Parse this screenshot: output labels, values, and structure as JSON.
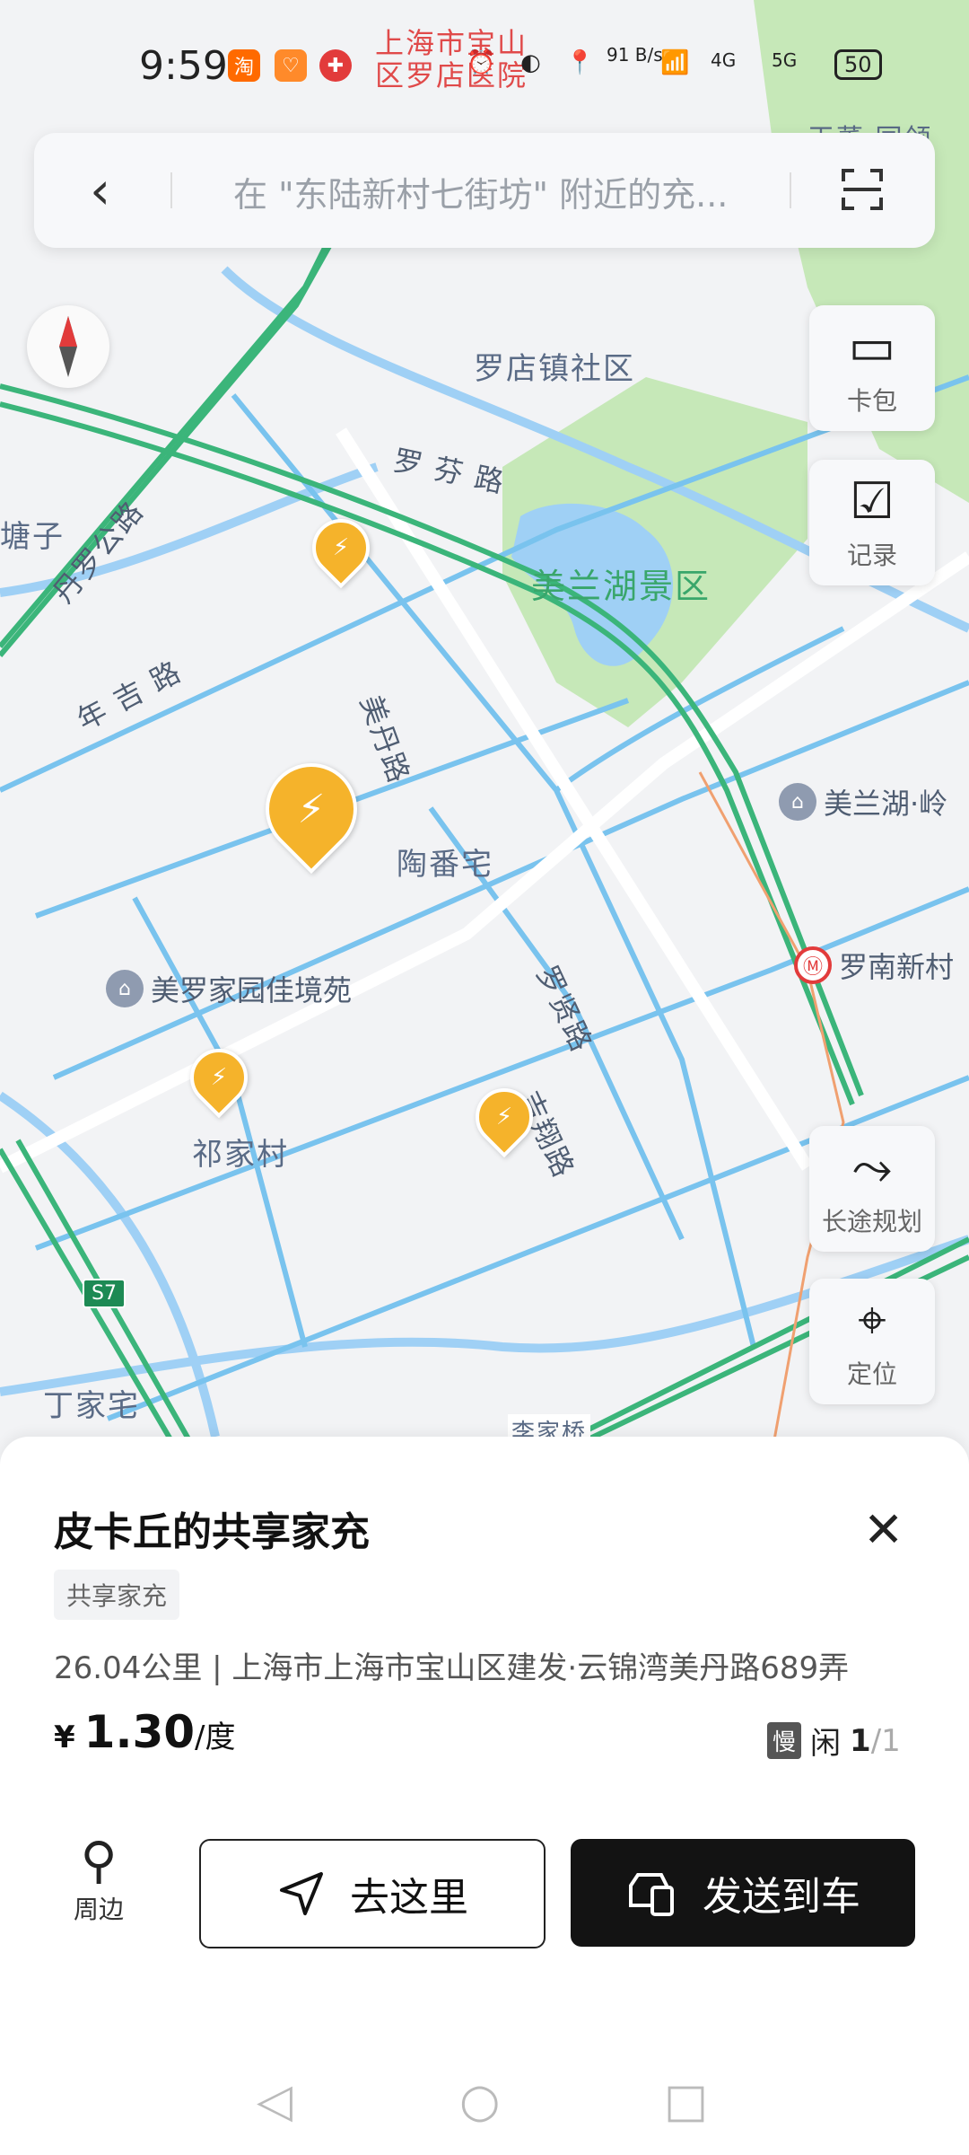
{
  "status_bar": {
    "time": "9:59",
    "app_icons": [
      "taobao-icon",
      "heart-app-icon",
      "medical-pin-icon"
    ],
    "network_speed": "91 B/s",
    "signal_1": "4G",
    "signal_2": "5G",
    "battery": "50"
  },
  "search": {
    "placeholder": "在 \"东陆新村七街坊\" 附近的充..."
  },
  "map": {
    "labels": [
      {
        "id": "luodian-community",
        "text": "罗店镇社区"
      },
      {
        "id": "luofen-road",
        "text": "罗 芬 路"
      },
      {
        "id": "danluo-road",
        "text": "丹罗公路"
      },
      {
        "id": "meilan-lake",
        "text": "美兰湖景区"
      },
      {
        "id": "nianji-road",
        "text": "年 吉 路"
      },
      {
        "id": "meidan-road",
        "text": "美丹路"
      },
      {
        "id": "taofanzhai",
        "text": "陶番宅"
      },
      {
        "id": "luoxian-road",
        "text": "罗贤路"
      },
      {
        "id": "jixiang-road",
        "text": "吉翔路"
      },
      {
        "id": "qijiacun",
        "text": "祁家村"
      },
      {
        "id": "dingjiazhai",
        "text": "丁家宅"
      },
      {
        "id": "lijiaqiao",
        "text": "李家桥"
      },
      {
        "id": "tangzi",
        "text": "塘子"
      },
      {
        "id": "hospital",
        "text": "上海市宝山区罗店医院"
      },
      {
        "id": "top-right-place",
        "text": "王董·园领"
      }
    ],
    "pois": [
      {
        "id": "meiluo-garden",
        "text": "美罗家园佳境苑"
      },
      {
        "id": "meilanhu-ling",
        "text": "美兰湖·岭"
      },
      {
        "id": "luonan-metro",
        "text": "罗南新村"
      }
    ],
    "highway_badge": "S7",
    "highlight_color": "#f5b32b",
    "water_color": "#9fd0f5",
    "park_color": "#bfe3b1",
    "road_color": "#77c6f0"
  },
  "tools": {
    "wallet": "卡包",
    "records": "记录",
    "route": "长途规划",
    "locate": "定位"
  },
  "sheet": {
    "title": "皮卡丘的共享家充",
    "tag": "共享家充",
    "address": "26.04公里 | 上海市上海市宝山区建发·云锦湾美丹路689弄",
    "currency": "¥",
    "price": "1.30",
    "unit": "/度",
    "speed_badge": "慢",
    "status": "闲",
    "available": "1",
    "total": "/1",
    "nearby_label": "周边",
    "go_label": "去这里",
    "send_label": "发送到车"
  }
}
